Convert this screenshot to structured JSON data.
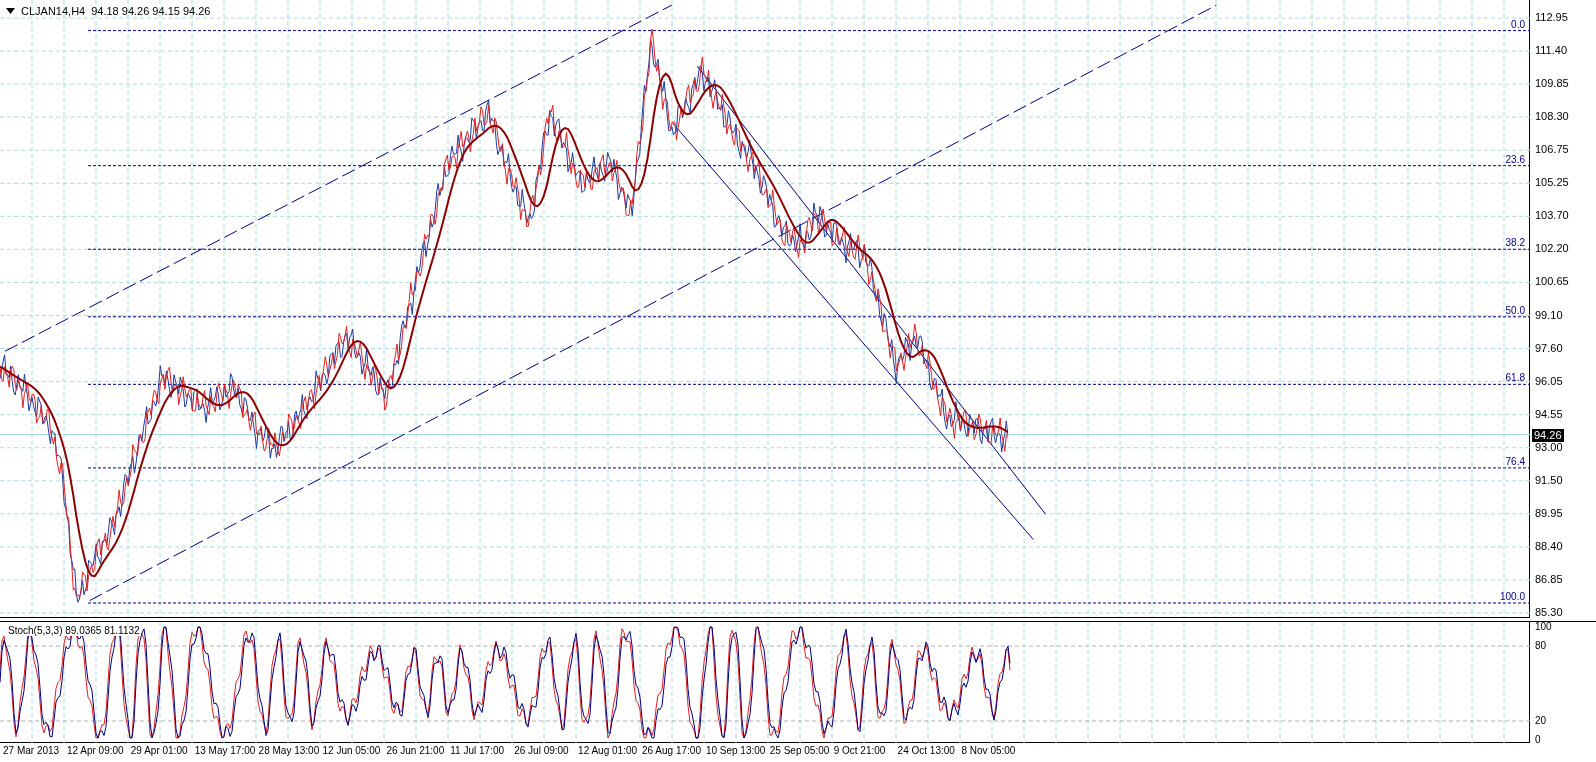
{
  "header": {
    "symbol": "CLJAN14,H4",
    "ohlc": "94.18 94.26 94.15 94.26"
  },
  "price_axis": [
    "112.95",
    "111.40",
    "109.85",
    "108.30",
    "106.75",
    "105.25",
    "103.70",
    "102.20",
    "100.65",
    "99.10",
    "97.60",
    "96.05",
    "94.55",
    "93.00",
    "91.50",
    "89.95",
    "88.40",
    "86.85",
    "85.30"
  ],
  "current_price": "94.26",
  "fibonacci_levels": [
    "0.0",
    "23.6",
    "38.2",
    "50.0",
    "61.8",
    "76.4",
    "100.0"
  ],
  "indicator": {
    "label": "Stoch(5,3,3) 89.0365 81.1132",
    "axis": [
      "100",
      "80",
      "20",
      "0"
    ]
  },
  "time_axis": [
    "27 Mar 2013",
    "12 Apr 09:00",
    "29 Apr 01:00",
    "13 May 17:00",
    "28 May 13:00",
    "12 Jun 05:00",
    "26 Jun 21:00",
    "11 Jul 17:00",
    "26 Jul 09:00",
    "12 Aug 01:00",
    "26 Aug 17:00",
    "10 Sep 13:00",
    "25 Sep 05:00",
    "9 Oct 21:00",
    "24 Oct 13:00",
    "8 Nov 05:00"
  ]
}
